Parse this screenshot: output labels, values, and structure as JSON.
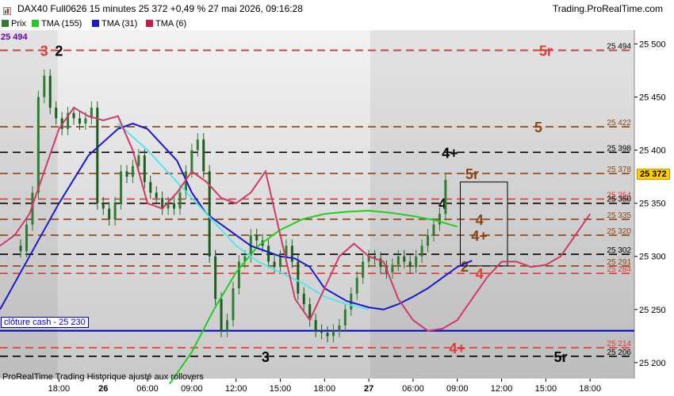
{
  "window": {
    "title": "DAX40 Full0626 15 minutes 25 372 +0,49 % 27 mai 2026, 09:16:28",
    "brand": "Trading.ProRealTime.com",
    "footer_note": "ProRealTime Trading  Historique ajusté aux rollovers",
    "cash_close_label": "clôture cash -  25 230",
    "current_price_tag": "25 372",
    "start_price_tag": "25 494"
  },
  "legend": [
    {
      "label": "Prix",
      "color": "#2e7d32"
    },
    {
      "label": "TMA (155)",
      "color": "#22cc22"
    },
    {
      "label": "TMA (31)",
      "color": "#1a1acc"
    },
    {
      "label": "TMA (6)",
      "color": "#cc1a44"
    }
  ],
  "chart_data": {
    "type": "candlestick",
    "x_ticks": [
      {
        "label": "18:00",
        "t": 2,
        "bold": false
      },
      {
        "label": "26",
        "t": 8,
        "bold": true
      },
      {
        "label": "06:00",
        "t": 14,
        "bold": false
      },
      {
        "label": "09:00",
        "t": 20,
        "bold": false
      },
      {
        "label": "12:00",
        "t": 26,
        "bold": false
      },
      {
        "label": "15:00",
        "t": 32,
        "bold": false
      },
      {
        "label": "18:00",
        "t": 38,
        "bold": false
      },
      {
        "label": "27",
        "t": 44,
        "bold": true
      },
      {
        "label": "06:00",
        "t": 50,
        "bold": false
      },
      {
        "label": "09:00",
        "t": 56,
        "bold": false
      },
      {
        "label": "12:00",
        "t": 62,
        "bold": false
      },
      {
        "label": "15:00",
        "t": 68,
        "bold": false
      },
      {
        "label": "18:00",
        "t": 74,
        "bold": false
      }
    ],
    "y_ticks": [
      25200,
      25250,
      25300,
      25350,
      25400,
      25450,
      25500
    ],
    "ylim": [
      25185,
      25513
    ],
    "xlim": [
      -6,
      80
    ],
    "shaded_periods": [
      [
        -6,
        1.8
      ],
      [
        44.2,
        80
      ]
    ],
    "levels": [
      {
        "value": 25494,
        "label": "25 494",
        "name": "2",
        "name_t": 2,
        "color": "#000000",
        "style": "dash"
      },
      {
        "value": 25494,
        "label": "",
        "name": "3",
        "name_t": 0,
        "color": "#e53935",
        "style": "none"
      },
      {
        "value": 25494,
        "label": "",
        "name": "5r",
        "name_t": 68,
        "color": "#e53935",
        "style": "dash"
      },
      {
        "value": 25422,
        "label": "25 422",
        "name": "5",
        "name_t": 67,
        "color": "#8b4513",
        "style": "dash"
      },
      {
        "value": 25398,
        "label": "25 398",
        "name": "4+",
        "name_t": 55,
        "color": "#000000",
        "style": "dash"
      },
      {
        "value": 25378,
        "label": "25 378",
        "name": "5r",
        "name_t": 58,
        "color": "#8b4513",
        "style": "dash"
      },
      {
        "value": 25354,
        "label": "25 354",
        "name": "",
        "name_t": 0,
        "color": "#e53935",
        "style": "dash"
      },
      {
        "value": 25350,
        "label": "25 350",
        "name": "4",
        "name_t": 54,
        "color": "#000000",
        "style": "dash"
      },
      {
        "value": 25335,
        "label": "25 335",
        "name": "4",
        "name_t": 59,
        "color": "#8b4513",
        "style": "dash"
      },
      {
        "value": 25320,
        "label": "25 320",
        "name": "4+",
        "name_t": 59,
        "color": "#8b4513",
        "style": "dash"
      },
      {
        "value": 25302,
        "label": "25 302",
        "name": "",
        "name_t": 0,
        "color": "#000000",
        "style": "dash"
      },
      {
        "value": 25291,
        "label": "25 291",
        "name": "2",
        "name_t": 57,
        "color": "#8b4513",
        "style": "dash"
      },
      {
        "value": 25284,
        "label": "25 284",
        "name": "4",
        "name_t": 59,
        "color": "#e53935",
        "style": "dash"
      },
      {
        "value": 25230,
        "label": "",
        "name": "",
        "name_t": 0,
        "color": "#0000c0",
        "style": "solid"
      },
      {
        "value": 25214,
        "label": "25 214",
        "name": "4+",
        "name_t": 56,
        "color": "#e53935",
        "style": "dash"
      },
      {
        "value": 25206,
        "label": "25 206",
        "name": "5r",
        "name_t": 70,
        "color": "#000000",
        "style": "dash"
      },
      {
        "value": 25206,
        "label": "",
        "name": "3",
        "name_t": 30,
        "color": "#000000",
        "style": "none"
      }
    ],
    "box": {
      "t0": 56.4,
      "t1": 62.8,
      "y_top": 25370,
      "y_bottom": 25291
    },
    "prices": [
      25310,
      25305,
      25330,
      25360,
      25450,
      25470,
      25440,
      25430,
      25420,
      25435,
      25430,
      25425,
      25430,
      25440,
      25350,
      25345,
      25335,
      25350,
      25380,
      25375,
      25385,
      25395,
      25370,
      25360,
      25355,
      25345,
      25350,
      25345,
      25360,
      25380,
      25400,
      25410,
      25380,
      25300,
      25260,
      25230,
      25240,
      25270,
      25295,
      25300,
      25320,
      25315,
      25310,
      25295,
      25290,
      25300,
      25310,
      25295,
      25265,
      25255,
      25240,
      25230,
      25228,
      25225,
      25230,
      25235,
      25250,
      25265,
      25280,
      25295,
      25300,
      25298,
      25290,
      25285,
      25292,
      25300,
      25295,
      25290,
      25300,
      25310,
      25320,
      25330,
      25340,
      25372
    ],
    "price_t0": -4,
    "price_dt": 0.8,
    "tma155": [
      [
        17,
        25180
      ],
      [
        20,
        25210
      ],
      [
        23,
        25250
      ],
      [
        26,
        25285
      ],
      [
        29,
        25310
      ],
      [
        32,
        25325
      ],
      [
        35,
        25335
      ],
      [
        38,
        25340
      ],
      [
        41,
        25342
      ],
      [
        44,
        25343
      ],
      [
        47,
        25341
      ],
      [
        50,
        25338
      ],
      [
        53,
        25334
      ],
      [
        56,
        25328
      ]
    ],
    "tma31": [
      [
        -6,
        25250
      ],
      [
        -2,
        25300
      ],
      [
        2,
        25350
      ],
      [
        6,
        25395
      ],
      [
        10,
        25420
      ],
      [
        12,
        25425
      ],
      [
        14,
        25420
      ],
      [
        16,
        25405
      ],
      [
        18,
        25390
      ],
      [
        20,
        25360
      ],
      [
        22,
        25340
      ],
      [
        25,
        25325
      ],
      [
        28,
        25310
      ],
      [
        30,
        25305
      ],
      [
        32,
        25300
      ],
      [
        34,
        25298
      ],
      [
        36,
        25290
      ],
      [
        38,
        25270
      ],
      [
        41,
        25258
      ],
      [
        44,
        25252
      ],
      [
        46,
        25250
      ],
      [
        48,
        25255
      ],
      [
        50,
        25262
      ],
      [
        52,
        25270
      ],
      [
        54,
        25280
      ],
      [
        56,
        25290
      ],
      [
        58,
        25296
      ]
    ],
    "tma31_cyan": [
      [
        10,
        25425
      ],
      [
        14,
        25400
      ],
      [
        18,
        25370
      ],
      [
        20,
        25355
      ],
      [
        22,
        25340
      ],
      [
        24,
        25325
      ],
      [
        26,
        25310
      ],
      [
        29,
        25295
      ],
      [
        32,
        25285
      ],
      [
        35,
        25275
      ],
      [
        38,
        25262
      ],
      [
        41,
        25255
      ],
      [
        44,
        25250
      ]
    ],
    "tma6": [
      [
        -6,
        25310
      ],
      [
        -4,
        25320
      ],
      [
        -2,
        25340
      ],
      [
        0,
        25380
      ],
      [
        2,
        25420
      ],
      [
        4,
        25440
      ],
      [
        6,
        25432
      ],
      [
        8,
        25428
      ],
      [
        10,
        25432
      ],
      [
        12,
        25400
      ],
      [
        14,
        25350
      ],
      [
        16,
        25345
      ],
      [
        18,
        25360
      ],
      [
        20,
        25380
      ],
      [
        22,
        25370
      ],
      [
        24,
        25355
      ],
      [
        26,
        25350
      ],
      [
        28,
        25360
      ],
      [
        30,
        25380
      ],
      [
        32,
        25320
      ],
      [
        34,
        25260
      ],
      [
        36,
        25240
      ],
      [
        38,
        25270
      ],
      [
        40,
        25300
      ],
      [
        42,
        25312
      ],
      [
        44,
        25300
      ],
      [
        46,
        25295
      ],
      [
        48,
        25260
      ],
      [
        50,
        25240
      ],
      [
        52,
        25230
      ],
      [
        54,
        25232
      ],
      [
        56,
        25240
      ],
      [
        58,
        25260
      ],
      [
        60,
        25280
      ],
      [
        62,
        25295
      ],
      [
        64,
        25295
      ],
      [
        66,
        25290
      ],
      [
        68,
        25292
      ],
      [
        70,
        25300
      ],
      [
        72,
        25320
      ],
      [
        74,
        25340
      ]
    ]
  }
}
